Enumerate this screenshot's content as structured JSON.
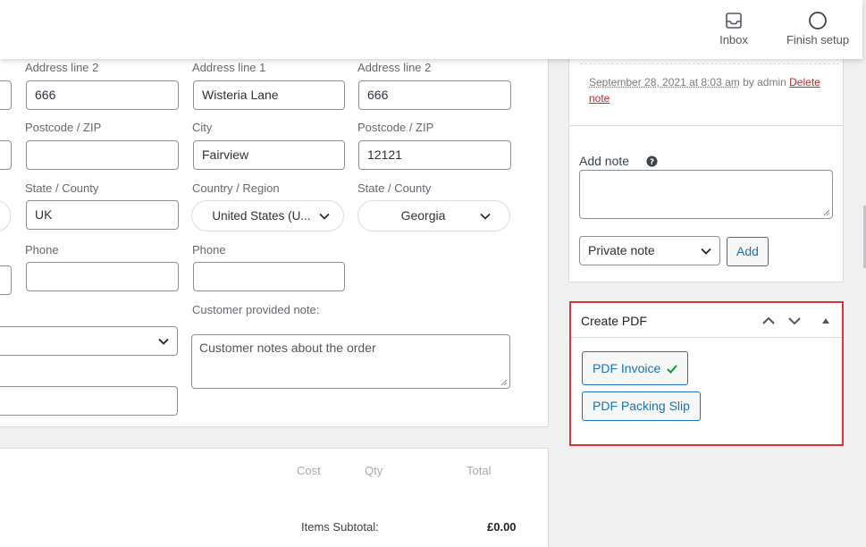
{
  "header": {
    "inbox_label": "Inbox",
    "finish_setup_label": "Finish setup"
  },
  "billing_partial": {
    "address2_label": "Address line 2",
    "address2_value": "666",
    "postcode_label": "Postcode / ZIP",
    "postcode_value": "",
    "state_label": "State / County",
    "state_value": "UK",
    "phone_label": "Phone",
    "phone_value": ""
  },
  "shipping": {
    "address1_label": "Address line 1",
    "address1_value": "Wisteria Lane",
    "address2_label": "Address line 2",
    "address2_value": "666",
    "city_label": "City",
    "city_value": "Fairview",
    "postcode_label": "Postcode / ZIP",
    "postcode_value": "12121",
    "country_label": "Country / Region",
    "country_value": "United States (U...",
    "state_label": "State / County",
    "state_value": "Georgia",
    "phone_label": "Phone",
    "phone_value": "",
    "customer_note_label": "Customer provided note:",
    "customer_note_placeholder": "Customer notes about the order"
  },
  "items": {
    "col_cost": "Cost",
    "col_qty": "Qty",
    "col_total": "Total",
    "subtotal_label": "Items Subtotal:",
    "subtotal_value": "£0.00"
  },
  "notes": {
    "meta_date": "September 28, 2021 at 8:03 am",
    "meta_by": " by admin ",
    "delete_label": "Delete",
    "delete_label_2": "note",
    "add_note_label": "Add note",
    "note_type_value": "Private note",
    "add_button": "Add"
  },
  "pdf": {
    "title": "Create PDF",
    "invoice_button": "PDF Invoice",
    "packing_slip_button": "PDF Packing Slip"
  },
  "colors": {
    "link": "#2271b1",
    "danger": "#d63638",
    "check": "#00a32a"
  },
  "icons": [
    "inbox-icon",
    "circle-icon",
    "chevron-down-icon",
    "help-icon",
    "arrow-up-icon",
    "arrow-down-icon",
    "triangle-up-icon",
    "checkmark-icon"
  ]
}
